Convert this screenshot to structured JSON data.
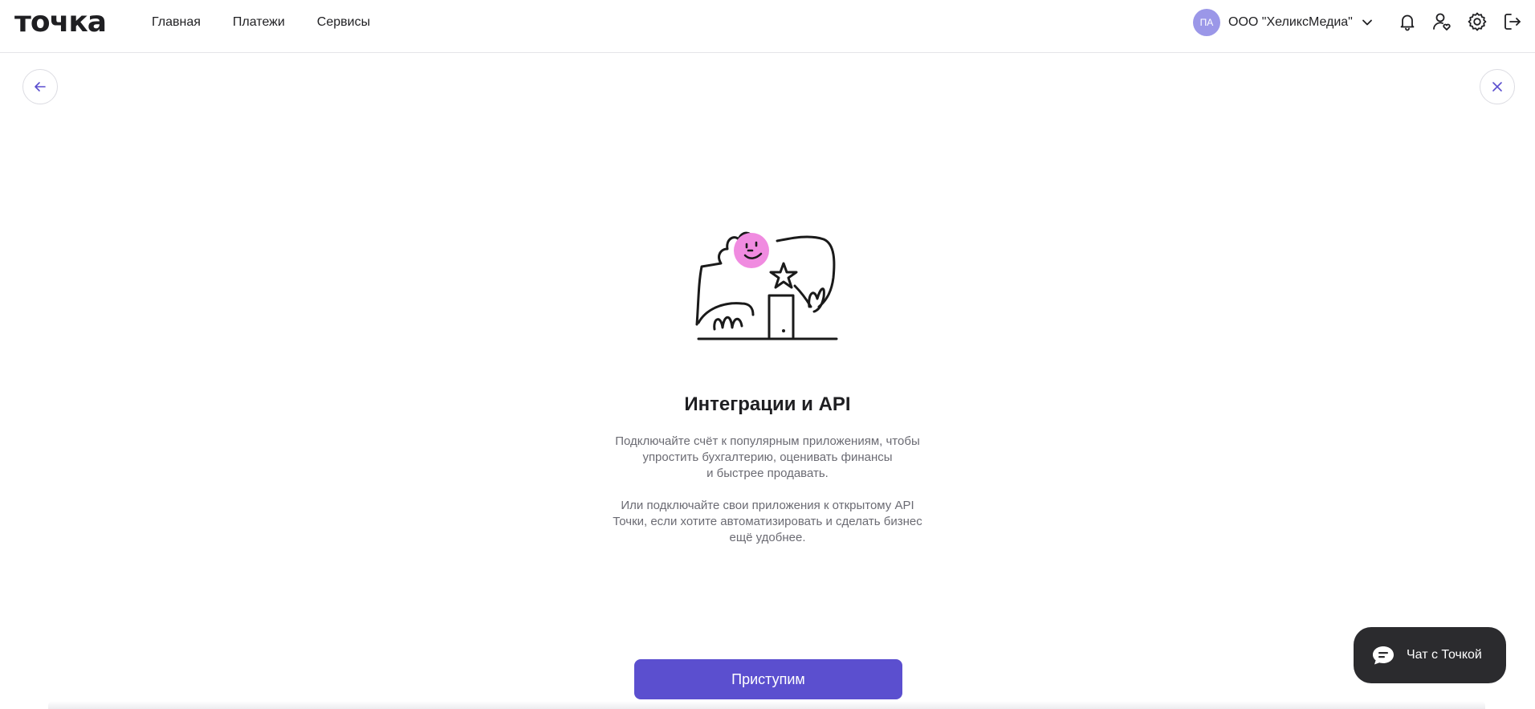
{
  "header": {
    "logo": "точка",
    "nav": [
      "Главная",
      "Платежи",
      "Сервисы"
    ],
    "account": {
      "initials": "ПА",
      "name": "ООО \"ХеликсМедиа\""
    },
    "icons": [
      "bell-icon",
      "user-heart-icon",
      "gear-icon",
      "logout-icon"
    ]
  },
  "page": {
    "title": "Интеграции и API",
    "description_1": "Подключайте счёт к популярным приложениям, чтобы\nупростить бухгалтерию, оценивать финансы\nи быстрее продавать.",
    "description_2": "Или подключайте свои приложения к открытому API\nТочки, если хотите автоматизировать и сделать бизнес\nещё удобнее.",
    "primary_button": "Приступим"
  },
  "chat": {
    "label": "Чат с Точкой"
  },
  "colors": {
    "accent": "#5b4fcf",
    "avatar": "#9b97e8",
    "chat_bg": "#2b2b2e",
    "illustration_face": "#f08be0"
  }
}
